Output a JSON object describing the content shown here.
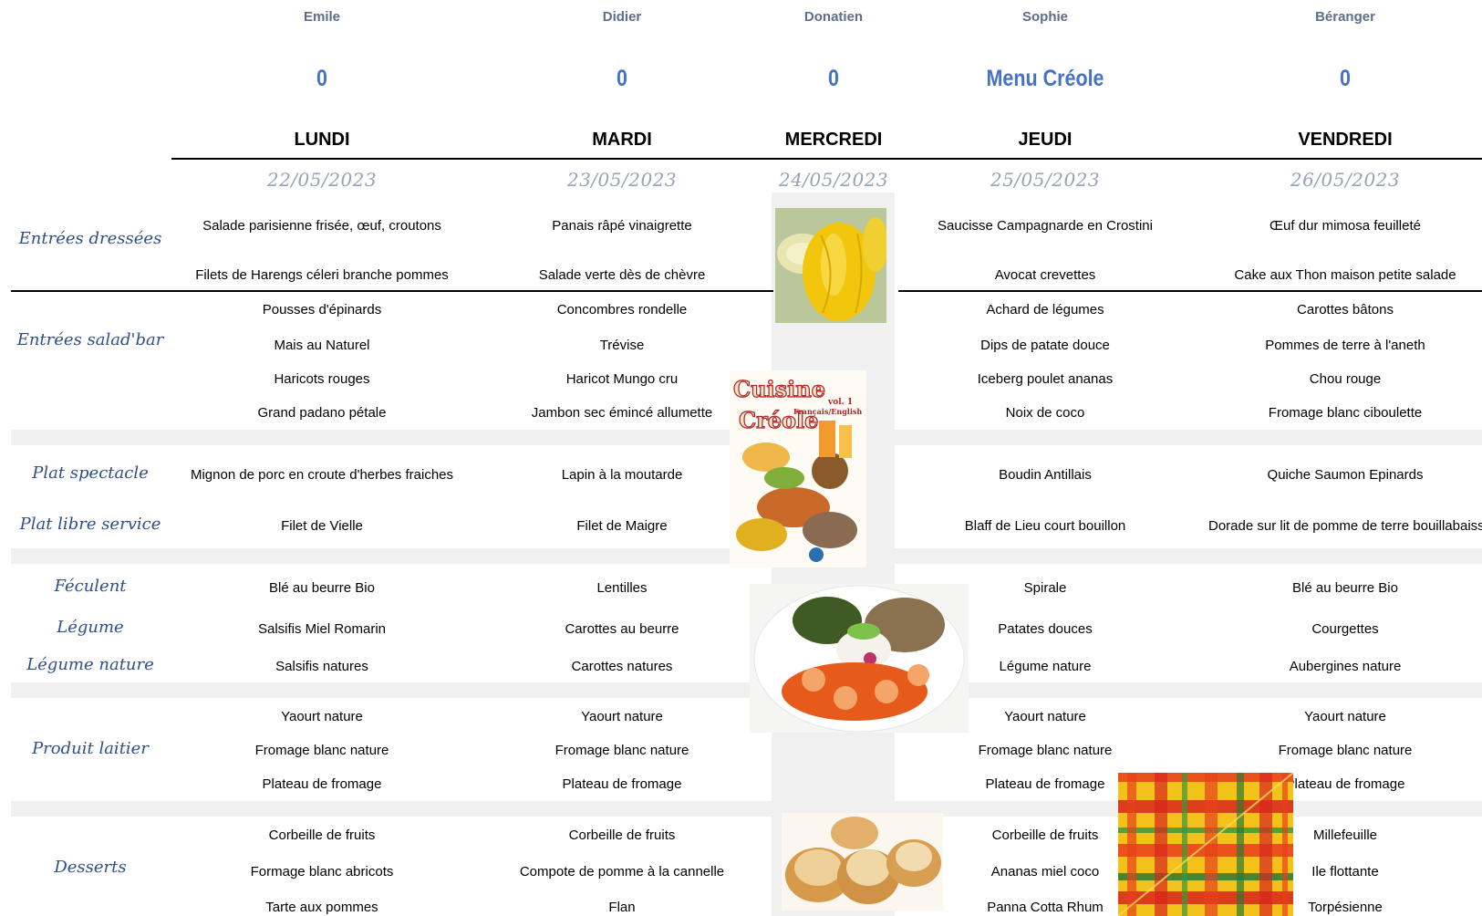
{
  "people": [
    "Emile",
    "Didier",
    "Donatien",
    "Sophie",
    "Béranger"
  ],
  "themes": [
    "0",
    "0",
    "0",
    "Menu Créole",
    "0"
  ],
  "days": [
    "LUNDI",
    "MARDI",
    "MERCREDI",
    "JEUDI",
    "VENDREDI"
  ],
  "dates": [
    "22/05/2023",
    "23/05/2023",
    "24/05/2023",
    "25/05/2023",
    "26/05/2023"
  ],
  "categories": {
    "entrees_dressees": "Entrées dressées",
    "entrees_saladbar": "Entrées salad'bar",
    "plat_spectacle": "Plat spectacle",
    "plat_libre_service": "Plat libre service",
    "feculent": "Féculent",
    "legume": "Légume",
    "legume_nature": "Légume nature",
    "produit_laitier": "Produit laitier",
    "desserts": "Desserts"
  },
  "menu": {
    "lundi": {
      "entrees_dressees": [
        "Salade parisienne frisée, œuf, croutons",
        "Filets de Harengs céleri branche pommes"
      ],
      "entrees_saladbar": [
        "Pousses d'épinards",
        "Mais au Naturel",
        "Haricots rouges",
        "Grand padano pétale"
      ],
      "plat_spectacle": "Mignon de porc en croute d'herbes fraiches",
      "plat_libre_service": "Filet de Vielle",
      "feculent": "Blé au beurre Bio",
      "legume": "Salsifis Miel Romarin",
      "legume_nature": "Salsifis natures",
      "produit_laitier": [
        "Yaourt nature",
        "Fromage blanc nature",
        "Plateau de fromage"
      ],
      "desserts": [
        "Corbeille de fruits",
        "Formage blanc abricots",
        "Tarte aux pommes"
      ]
    },
    "mardi": {
      "entrees_dressees": [
        "Panais râpé vinaigrette",
        "Salade verte dès de chèvre"
      ],
      "entrees_saladbar": [
        "Concombres rondelle",
        "Trévise",
        "Haricot Mungo cru",
        "Jambon sec émincé allumette"
      ],
      "plat_spectacle": "Lapin à la moutarde",
      "plat_libre_service": "Filet de Maigre",
      "feculent": "Lentilles",
      "legume": "Carottes au beurre",
      "legume_nature": "Carottes natures",
      "produit_laitier": [
        "Yaourt nature",
        "Fromage blanc nature",
        "Plateau de fromage"
      ],
      "desserts": [
        "Corbeille de fruits",
        "Compote de pomme à la cannelle",
        "Flan"
      ]
    },
    "jeudi": {
      "entrees_dressees": [
        "Saucisse Campagnarde en Crostini",
        "Avocat crevettes"
      ],
      "entrees_saladbar": [
        "Achard de légumes",
        "Dips de patate douce",
        "Iceberg poulet ananas",
        "Noix de coco"
      ],
      "plat_spectacle": "Boudin Antillais",
      "plat_libre_service": "Blaff de Lieu court bouillon",
      "feculent": "Spirale",
      "legume": "Patates douces",
      "legume_nature": "Légume nature",
      "produit_laitier": [
        "Yaourt nature",
        "Fromage blanc nature",
        "Plateau de fromage"
      ],
      "desserts": [
        "Corbeille de fruits",
        "Ananas miel coco",
        "Panna Cotta Rhum"
      ]
    },
    "vendredi": {
      "entrees_dressees": [
        "Œuf dur mimosa feuilleté",
        "Cake aux Thon maison petite salade"
      ],
      "entrees_saladbar": [
        "Carottes bâtons",
        "Pommes de terre à l'aneth",
        "Chou rouge",
        "Fromage blanc ciboulette"
      ],
      "plat_spectacle": "Quiche Saumon Epinards",
      "plat_libre_service": "Dorade sur lit de pomme de terre bouillabaisse",
      "feculent": "Blé au beurre Bio",
      "legume": "Courgettes",
      "legume_nature": "Aubergines nature",
      "produit_laitier": [
        "Yaourt nature",
        "Fromage blanc nature",
        "Plateau de fromage"
      ],
      "desserts": [
        "Millefeuille",
        "Ile flottante",
        "Torpésienne"
      ]
    }
  },
  "book_cover": {
    "title_line1": "Cuisine",
    "title_line2": "Créole",
    "volume": "vol. 1",
    "languages": "Français/English"
  },
  "colors": {
    "theme_blue": "#4472c4",
    "category_blue": "#2f4f8a",
    "date_grey": "#95a2b8",
    "person_grey": "#5b6e8a",
    "band_grey": "#f0f0f0"
  }
}
